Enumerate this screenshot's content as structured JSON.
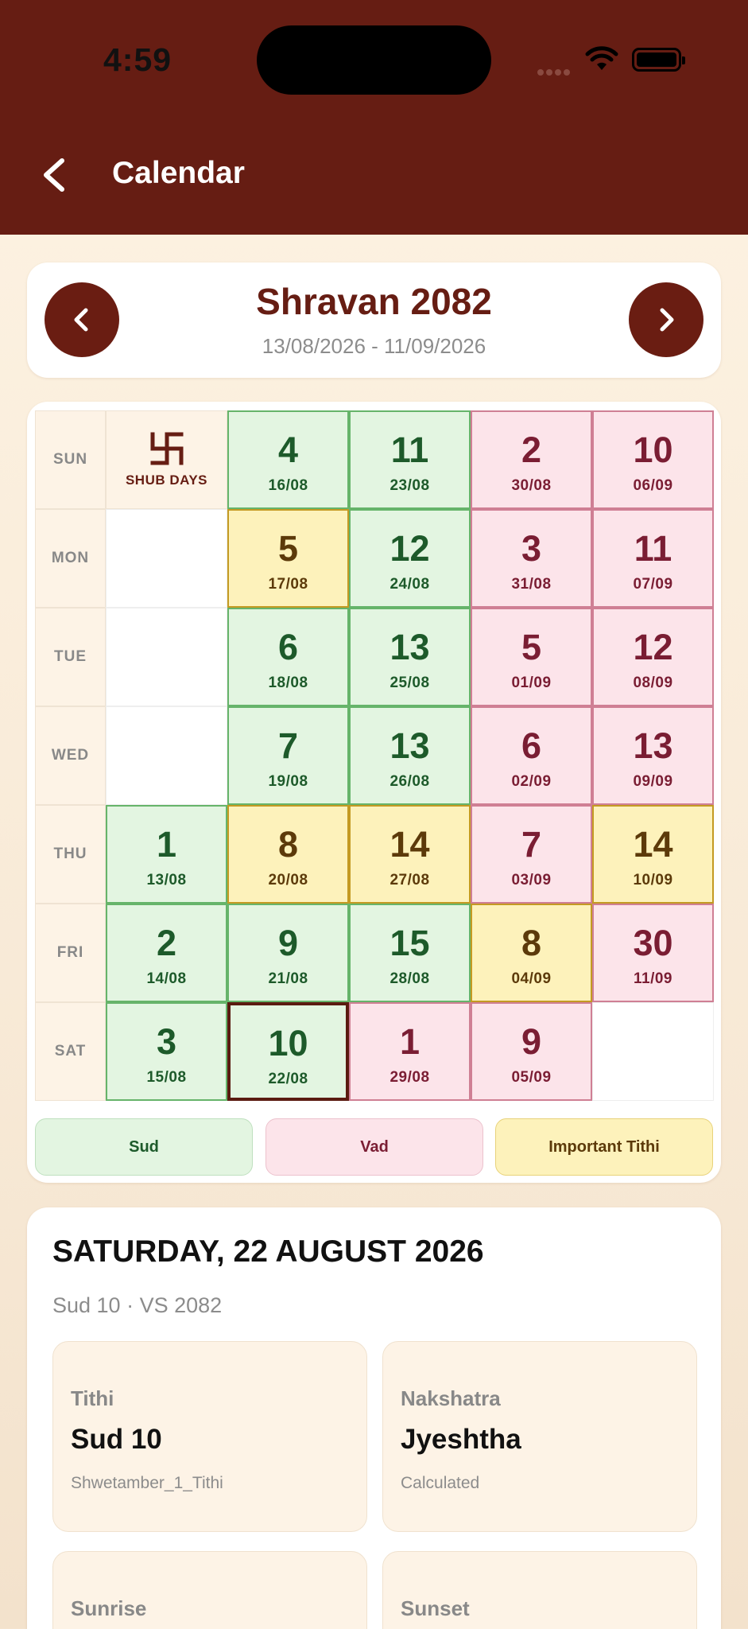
{
  "status_bar": {
    "time": "4:59"
  },
  "header": {
    "title": "Calendar",
    "back_icon": "chevron-left-icon"
  },
  "month_nav": {
    "title": "Shravan 2082",
    "range": "13/08/2026 - 11/09/2026",
    "prev_icon": "chevron-left-icon",
    "next_icon": "chevron-right-icon"
  },
  "calendar": {
    "weekdays": [
      "SUN",
      "MON",
      "TUE",
      "WED",
      "THU",
      "FRI",
      "SAT"
    ],
    "shub_label": "SHUB DAYS",
    "columns": [
      [
        {
          "type": "shub"
        },
        {
          "type": "blank"
        },
        {
          "type": "blank"
        },
        {
          "type": "blank"
        },
        {
          "n": "1",
          "d": "13/08",
          "type": "sud"
        },
        {
          "n": "2",
          "d": "14/08",
          "type": "sud"
        },
        {
          "n": "3",
          "d": "15/08",
          "type": "sud"
        }
      ],
      [
        {
          "n": "4",
          "d": "16/08",
          "type": "sud"
        },
        {
          "n": "5",
          "d": "17/08",
          "type": "imp"
        },
        {
          "n": "6",
          "d": "18/08",
          "type": "sud"
        },
        {
          "n": "7",
          "d": "19/08",
          "type": "sud"
        },
        {
          "n": "8",
          "d": "20/08",
          "type": "imp"
        },
        {
          "n": "9",
          "d": "21/08",
          "type": "sud"
        },
        {
          "n": "10",
          "d": "22/08",
          "type": "sud",
          "selected": true
        }
      ],
      [
        {
          "n": "11",
          "d": "23/08",
          "type": "sud"
        },
        {
          "n": "12",
          "d": "24/08",
          "type": "sud"
        },
        {
          "n": "13",
          "d": "25/08",
          "type": "sud"
        },
        {
          "n": "13",
          "d": "26/08",
          "type": "sud"
        },
        {
          "n": "14",
          "d": "27/08",
          "type": "imp"
        },
        {
          "n": "15",
          "d": "28/08",
          "type": "sud"
        },
        {
          "n": "1",
          "d": "29/08",
          "type": "vad"
        }
      ],
      [
        {
          "n": "2",
          "d": "30/08",
          "type": "vad"
        },
        {
          "n": "3",
          "d": "31/08",
          "type": "vad"
        },
        {
          "n": "5",
          "d": "01/09",
          "type": "vad"
        },
        {
          "n": "6",
          "d": "02/09",
          "type": "vad"
        },
        {
          "n": "7",
          "d": "03/09",
          "type": "vad"
        },
        {
          "n": "8",
          "d": "04/09",
          "type": "imp"
        },
        {
          "n": "9",
          "d": "05/09",
          "type": "vad"
        }
      ],
      [
        {
          "n": "10",
          "d": "06/09",
          "type": "vad"
        },
        {
          "n": "11",
          "d": "07/09",
          "type": "vad"
        },
        {
          "n": "12",
          "d": "08/09",
          "type": "vad"
        },
        {
          "n": "13",
          "d": "09/09",
          "type": "vad"
        },
        {
          "n": "14",
          "d": "10/09",
          "type": "imp"
        },
        {
          "n": "30",
          "d": "11/09",
          "type": "vad"
        },
        {
          "type": "blank"
        }
      ]
    ]
  },
  "legend": {
    "sud": "Sud",
    "vad": "Vad",
    "important": "Important Tithi"
  },
  "details": {
    "date_title": "SATURDAY, 22 AUGUST 2026",
    "subtitle": "Sud 10 · VS 2082",
    "cards": [
      {
        "key": "Tithi",
        "value": "Sud 10",
        "sub": "Shwetamber_1_Tithi"
      },
      {
        "key": "Nakshatra",
        "value": "Jyeshtha",
        "sub": "Calculated"
      },
      {
        "key": "Sunrise",
        "value": "",
        "sub": ""
      },
      {
        "key": "Sunset",
        "value": "",
        "sub": ""
      }
    ]
  }
}
